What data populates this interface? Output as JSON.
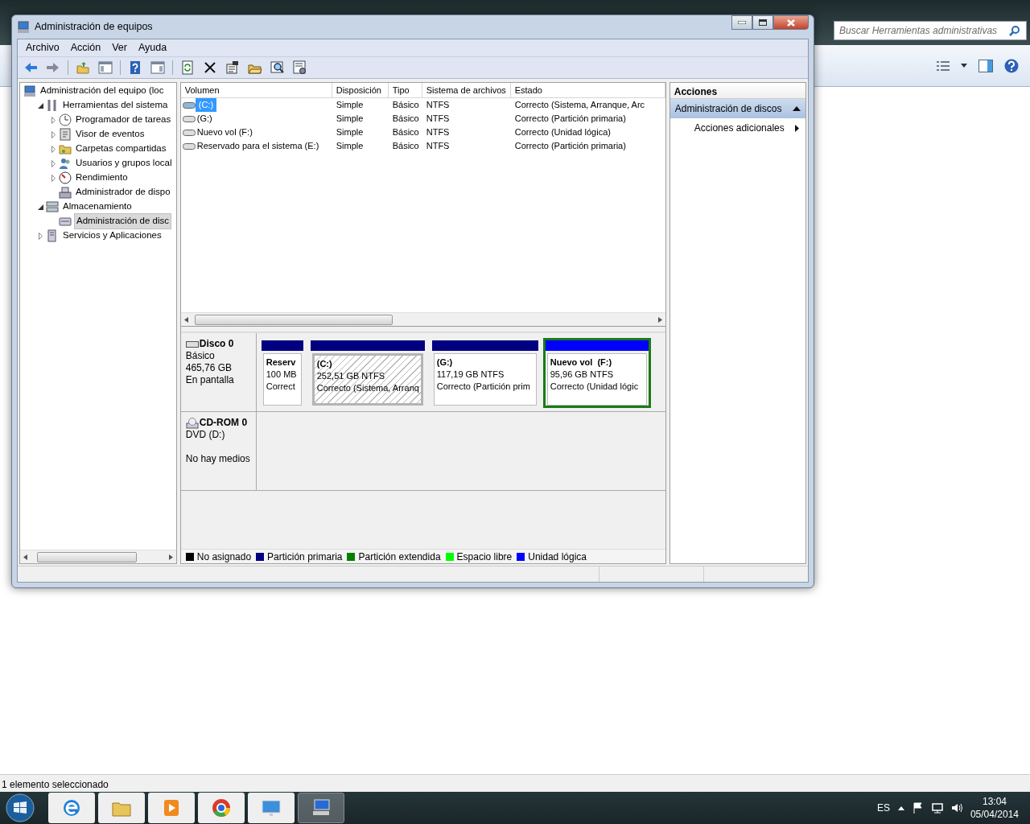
{
  "explorer": {
    "search": {
      "placeholder": "Buscar Herramientas administrativas"
    },
    "status_bar": "1 elemento seleccionado"
  },
  "window": {
    "title": "Administración de equipos",
    "menu": [
      "Archivo",
      "Acción",
      "Ver",
      "Ayuda"
    ],
    "tree": [
      {
        "label": "Administración del equipo (loc",
        "selected": false,
        "children": [
          {
            "label": "Herramientas del sistema",
            "expanded": true,
            "selected": false,
            "children": [
              {
                "label": "Programador de tareas",
                "expanded": false,
                "selected": false
              },
              {
                "label": "Visor de eventos",
                "expanded": false,
                "selected": false
              },
              {
                "label": "Carpetas compartidas",
                "expanded": false,
                "selected": false
              },
              {
                "label": "Usuarios y grupos local",
                "expanded": false,
                "selected": false
              },
              {
                "label": "Rendimiento",
                "expanded": false,
                "selected": false
              },
              {
                "label": "Administrador de dispo",
                "selected": false
              }
            ]
          },
          {
            "label": "Almacenamiento",
            "expanded": true,
            "selected": false,
            "children": [
              {
                "label": "Administración de disc",
                "selected": true
              }
            ]
          },
          {
            "label": "Servicios y Aplicaciones",
            "expanded": false,
            "selected": false
          }
        ]
      }
    ],
    "volumes": {
      "columns": [
        "Volumen",
        "Disposición",
        "Tipo",
        "Sistema de archivos",
        "Estado"
      ],
      "rows": [
        {
          "selected": true,
          "cells": [
            "(C:)",
            "Simple",
            "Básico",
            "NTFS",
            "Correcto (Sistema, Arranque, Arc"
          ]
        },
        {
          "selected": false,
          "cells": [
            "(G:)",
            "Simple",
            "Básico",
            "NTFS",
            "Correcto (Partición primaria)"
          ]
        },
        {
          "selected": false,
          "cells": [
            "Nuevo vol (F:)",
            "Simple",
            "Básico",
            "NTFS",
            "Correcto (Unidad lógica)"
          ]
        },
        {
          "selected": false,
          "cells": [
            "Reservado para el sistema (E:)",
            "Simple",
            "Básico",
            "NTFS",
            "Correcto (Partición primaria)"
          ]
        }
      ]
    },
    "disks": [
      {
        "kind": "disk",
        "name": "Disco 0",
        "lines": [
          "Básico",
          "465,76 GB",
          "En pantalla"
        ],
        "partitions": [
          {
            "kind": "primary",
            "color": "#000080",
            "selected": false,
            "label": "Reserv",
            "size": "100 MB",
            "status": "Correct"
          },
          {
            "kind": "primary",
            "color": "#000080",
            "selected": true,
            "label": "(C:)",
            "size": "252,51 GB NTFS",
            "status": "Correcto (Sistema, Arranq"
          },
          {
            "kind": "primary",
            "color": "#000080",
            "selected": false,
            "label": "(G:)",
            "size": "117,19 GB NTFS",
            "status": "Correcto (Partición prim"
          },
          {
            "kind": "logical",
            "color": "#0000ff",
            "selected": false,
            "label": "Nuevo vol  (F:)",
            "size": "95,96 GB NTFS",
            "status": "Correcto (Unidad lógic"
          }
        ]
      },
      {
        "kind": "cdrom",
        "name": "CD-ROM 0",
        "lines": [
          "DVD (D:)",
          "No hay medios"
        ]
      }
    ],
    "legend": [
      {
        "label": "No asignado",
        "color": "#000000"
      },
      {
        "label": "Partición primaria",
        "color": "#000080"
      },
      {
        "label": "Partición extendida",
        "color": "#008000"
      },
      {
        "label": "Espacio libre",
        "color": "#00ff00"
      },
      {
        "label": "Unidad lógica",
        "color": "#0000ff"
      }
    ],
    "actions": {
      "title": "Acciones",
      "section": "Administración de discos",
      "items": [
        "Acciones adicionales"
      ]
    }
  },
  "taskbar": {
    "apps": [
      {
        "kind": "browser",
        "selected": false
      },
      {
        "kind": "folder",
        "selected": false
      },
      {
        "kind": "media",
        "selected": false
      },
      {
        "kind": "chrome",
        "selected": false
      },
      {
        "kind": "panel",
        "selected": false
      },
      {
        "kind": "admin",
        "selected": true
      }
    ],
    "language": "ES",
    "time": "13:04",
    "date": "05/04/2014"
  }
}
